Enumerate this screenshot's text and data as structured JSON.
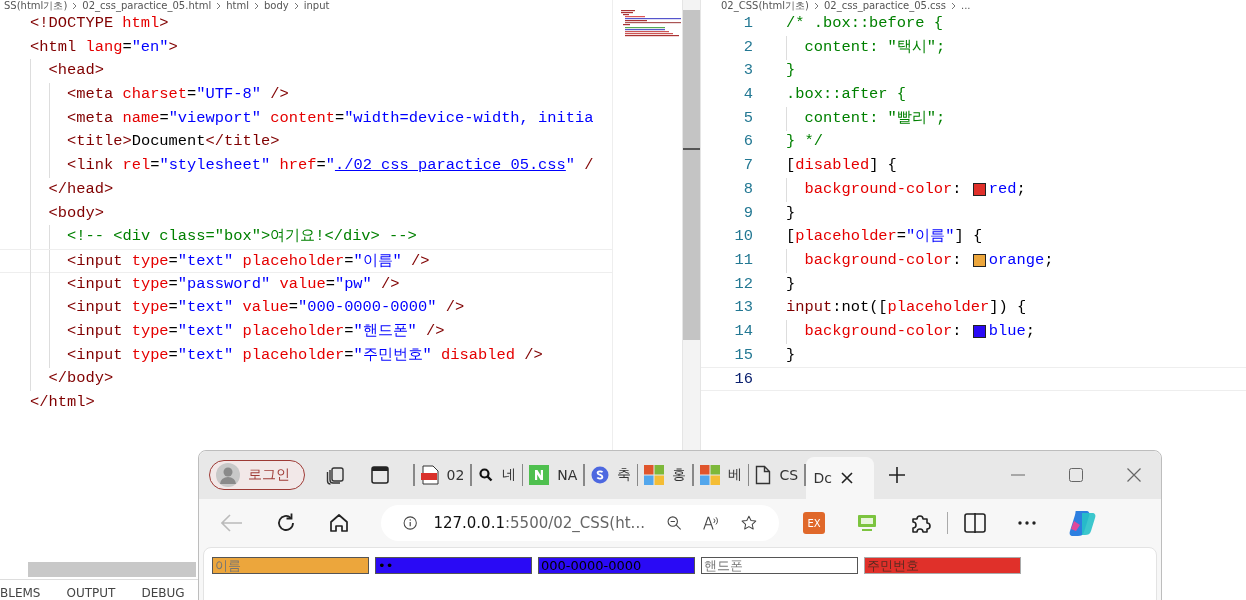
{
  "left_editor": {
    "breadcrumb": [
      "SS(html기초)",
      "02_css_paractice_05.html",
      "html",
      "body",
      "input"
    ],
    "lines": [
      {
        "tokens": [
          {
            "kind": "tag",
            "text": "<!DOCTYPE"
          },
          {
            "kind": "attr",
            "text": " html"
          },
          {
            "kind": "tag",
            "text": ">"
          }
        ]
      },
      {
        "tokens": [
          {
            "kind": "tag",
            "text": "<html"
          },
          {
            "kind": "attr",
            "text": " lang"
          },
          {
            "kind": "text",
            "text": "="
          },
          {
            "kind": "str",
            "text": "\"en\""
          },
          {
            "kind": "tag",
            "text": ">"
          }
        ],
        "children": [
          {
            "tokens": [
              {
                "kind": "tag",
                "text": "<head>"
              }
            ],
            "children": [
              {
                "tokens": [
                  {
                    "kind": "tag",
                    "text": "<meta"
                  },
                  {
                    "kind": "attr",
                    "text": " charset"
                  },
                  {
                    "kind": "text",
                    "text": "="
                  },
                  {
                    "kind": "str",
                    "text": "\"UTF-8\""
                  },
                  {
                    "kind": "tag",
                    "text": " />"
                  }
                ]
              },
              {
                "tokens": [
                  {
                    "kind": "tag",
                    "text": "<meta"
                  },
                  {
                    "kind": "attr",
                    "text": " name"
                  },
                  {
                    "kind": "text",
                    "text": "="
                  },
                  {
                    "kind": "str",
                    "text": "\"viewport\""
                  },
                  {
                    "kind": "attr",
                    "text": " content"
                  },
                  {
                    "kind": "text",
                    "text": "="
                  },
                  {
                    "kind": "str",
                    "text": "\"width=device-width, initia"
                  }
                ]
              },
              {
                "tokens": [
                  {
                    "kind": "tag",
                    "text": "<title>"
                  },
                  {
                    "kind": "text",
                    "text": "Document"
                  },
                  {
                    "kind": "tag",
                    "text": "</title>"
                  }
                ]
              },
              {
                "tokens": [
                  {
                    "kind": "tag",
                    "text": "<link"
                  },
                  {
                    "kind": "attr",
                    "text": " rel"
                  },
                  {
                    "kind": "text",
                    "text": "="
                  },
                  {
                    "kind": "str",
                    "text": "\"stylesheet\""
                  },
                  {
                    "kind": "attr",
                    "text": " href"
                  },
                  {
                    "kind": "text",
                    "text": "="
                  },
                  {
                    "kind": "str",
                    "text": "\""
                  },
                  {
                    "kind": "link",
                    "text": "./02_css_paractice_05.css"
                  },
                  {
                    "kind": "str",
                    "text": "\""
                  },
                  {
                    "kind": "tag",
                    "text": " /"
                  }
                ]
              }
            ]
          },
          {
            "tokens": [
              {
                "kind": "tag",
                "text": "</head>"
              }
            ]
          },
          {
            "tokens": [
              {
                "kind": "tag",
                "text": "<body>"
              }
            ],
            "children": [
              {
                "tokens": [
                  {
                    "kind": "comment",
                    "text": "<!-- <div class=\"box\">여기요!</div> -->"
                  }
                ]
              },
              {
                "current": true,
                "tokens": [
                  {
                    "kind": "tag",
                    "text": "<input"
                  },
                  {
                    "kind": "attr",
                    "text": " type"
                  },
                  {
                    "kind": "text",
                    "text": "="
                  },
                  {
                    "kind": "str",
                    "text": "\"text\""
                  },
                  {
                    "kind": "attr",
                    "text": " placeholder"
                  },
                  {
                    "kind": "text",
                    "text": "="
                  },
                  {
                    "kind": "str",
                    "text": "\"이름\""
                  },
                  {
                    "kind": "tag",
                    "text": " />"
                  }
                ]
              },
              {
                "tokens": [
                  {
                    "kind": "tag",
                    "text": "<input"
                  },
                  {
                    "kind": "attr",
                    "text": " type"
                  },
                  {
                    "kind": "text",
                    "text": "="
                  },
                  {
                    "kind": "str",
                    "text": "\"password\""
                  },
                  {
                    "kind": "attr",
                    "text": " value"
                  },
                  {
                    "kind": "text",
                    "text": "="
                  },
                  {
                    "kind": "str",
                    "text": "\"pw\""
                  },
                  {
                    "kind": "tag",
                    "text": " />"
                  }
                ]
              },
              {
                "tokens": [
                  {
                    "kind": "tag",
                    "text": "<input"
                  },
                  {
                    "kind": "attr",
                    "text": " type"
                  },
                  {
                    "kind": "text",
                    "text": "="
                  },
                  {
                    "kind": "str",
                    "text": "\"text\""
                  },
                  {
                    "kind": "attr",
                    "text": " value"
                  },
                  {
                    "kind": "text",
                    "text": "="
                  },
                  {
                    "kind": "str",
                    "text": "\"000-0000-0000\""
                  },
                  {
                    "kind": "tag",
                    "text": " />"
                  }
                ]
              },
              {
                "tokens": [
                  {
                    "kind": "tag",
                    "text": "<input"
                  },
                  {
                    "kind": "attr",
                    "text": " type"
                  },
                  {
                    "kind": "text",
                    "text": "="
                  },
                  {
                    "kind": "str",
                    "text": "\"text\""
                  },
                  {
                    "kind": "attr",
                    "text": " placeholder"
                  },
                  {
                    "kind": "text",
                    "text": "="
                  },
                  {
                    "kind": "str",
                    "text": "\"핸드폰\""
                  },
                  {
                    "kind": "tag",
                    "text": " />"
                  }
                ]
              },
              {
                "tokens": [
                  {
                    "kind": "tag",
                    "text": "<input"
                  },
                  {
                    "kind": "attr",
                    "text": " type"
                  },
                  {
                    "kind": "text",
                    "text": "="
                  },
                  {
                    "kind": "str",
                    "text": "\"text\""
                  },
                  {
                    "kind": "attr",
                    "text": " placeholder"
                  },
                  {
                    "kind": "text",
                    "text": "="
                  },
                  {
                    "kind": "str",
                    "text": "\"주민번호\""
                  },
                  {
                    "kind": "attr",
                    "text": " disabled"
                  },
                  {
                    "kind": "tag",
                    "text": " />"
                  }
                ]
              }
            ]
          },
          {
            "tokens": [
              {
                "kind": "tag",
                "text": "</body>"
              }
            ]
          }
        ]
      },
      {
        "tokens": [
          {
            "kind": "tag",
            "text": "</html>"
          }
        ]
      }
    ]
  },
  "right_editor": {
    "breadcrumb": [
      "02_CSS(html기초)",
      "02_css_paractice_05.css",
      "..."
    ],
    "lines": [
      {
        "number": "1",
        "tokens": [
          {
            "kind": "comment",
            "text": "/* .box::before {"
          }
        ]
      },
      {
        "number": "2",
        "indent": true,
        "tokens": [
          {
            "kind": "comment",
            "text": "content: \"택시\";"
          }
        ]
      },
      {
        "number": "3",
        "tokens": [
          {
            "kind": "comment",
            "text": "}"
          }
        ]
      },
      {
        "number": "4",
        "tokens": [
          {
            "kind": "comment",
            "text": ".box::after {"
          }
        ]
      },
      {
        "number": "5",
        "indent": true,
        "tokens": [
          {
            "kind": "comment",
            "text": "content: \"빨리\";"
          }
        ]
      },
      {
        "number": "6",
        "tokens": [
          {
            "kind": "comment",
            "text": "} */"
          }
        ]
      },
      {
        "number": "7",
        "tokens": [
          {
            "kind": "text",
            "text": "["
          },
          {
            "kind": "attr",
            "text": "disabled"
          },
          {
            "kind": "text",
            "text": "] {"
          }
        ]
      },
      {
        "number": "8",
        "indent": true,
        "tokens": [
          {
            "kind": "attr",
            "text": "background-color"
          },
          {
            "kind": "text",
            "text": ": "
          },
          {
            "kind": "swatch",
            "color": "#e0302a"
          },
          {
            "kind": "str",
            "text": "red"
          },
          {
            "kind": "text",
            "text": ";"
          }
        ]
      },
      {
        "number": "9",
        "tokens": [
          {
            "kind": "text",
            "text": "}"
          }
        ]
      },
      {
        "number": "10",
        "tokens": [
          {
            "kind": "text",
            "text": "["
          },
          {
            "kind": "attr",
            "text": "placeholder"
          },
          {
            "kind": "text",
            "text": "="
          },
          {
            "kind": "str",
            "text": "\"이름\""
          },
          {
            "kind": "text",
            "text": "] {"
          }
        ]
      },
      {
        "number": "11",
        "indent": true,
        "tokens": [
          {
            "kind": "attr",
            "text": "background-color"
          },
          {
            "kind": "text",
            "text": ": "
          },
          {
            "kind": "swatch",
            "color": "#eca63c"
          },
          {
            "kind": "str",
            "text": "orange"
          },
          {
            "kind": "text",
            "text": ";"
          }
        ]
      },
      {
        "number": "12",
        "tokens": [
          {
            "kind": "text",
            "text": "}"
          }
        ]
      },
      {
        "number": "13",
        "tokens": [
          {
            "kind": "tag",
            "text": "input"
          },
          {
            "kind": "text",
            "text": ":not(["
          },
          {
            "kind": "attr",
            "text": "placeholder"
          },
          {
            "kind": "text",
            "text": "]) {"
          }
        ]
      },
      {
        "number": "14",
        "indent": true,
        "tokens": [
          {
            "kind": "attr",
            "text": "background-color"
          },
          {
            "kind": "text",
            "text": ": "
          },
          {
            "kind": "swatch",
            "color": "#2a0af5"
          },
          {
            "kind": "str",
            "text": "blue"
          },
          {
            "kind": "text",
            "text": ";"
          }
        ]
      },
      {
        "number": "15",
        "tokens": [
          {
            "kind": "text",
            "text": "}"
          }
        ]
      },
      {
        "number": "16",
        "current": true
      }
    ]
  },
  "panel_tabs": [
    "BLEMS",
    "OUTPUT",
    "DEBUG"
  ],
  "browser": {
    "profile": {
      "label": "로그인"
    },
    "tabs": [
      {
        "kind": "pdf",
        "title": "02",
        "selected": false
      },
      {
        "kind": "search",
        "title": "네",
        "selected": false
      },
      {
        "kind": "n",
        "title": "NA",
        "selected": false
      },
      {
        "kind": "s",
        "title": "축",
        "selected": false
      },
      {
        "kind": "tiles",
        "title": "홍",
        "selected": false
      },
      {
        "kind": "tiles",
        "title": "베",
        "selected": false
      },
      {
        "kind": "page",
        "title": "CS",
        "selected": false
      },
      {
        "title": "Dc",
        "selected": true
      }
    ],
    "address": {
      "host": "127.0.0.1",
      "rest": ":5500/02_CSS(ht..."
    },
    "back_disabled": true,
    "extension_label": "EX",
    "inputs": [
      {
        "placeholder": "이름",
        "color": "#eca63c",
        "disabled": false
      },
      {
        "value": "••",
        "color": "#2a0af5",
        "disabled": false
      },
      {
        "value": "000-0000-0000",
        "color": "#2a0af5",
        "disabled": false
      },
      {
        "placeholder": "핸드폰",
        "color": "#ffffff",
        "disabled": false
      },
      {
        "placeholder": "주민번호",
        "color": "#e0302a",
        "disabled": true
      }
    ]
  }
}
